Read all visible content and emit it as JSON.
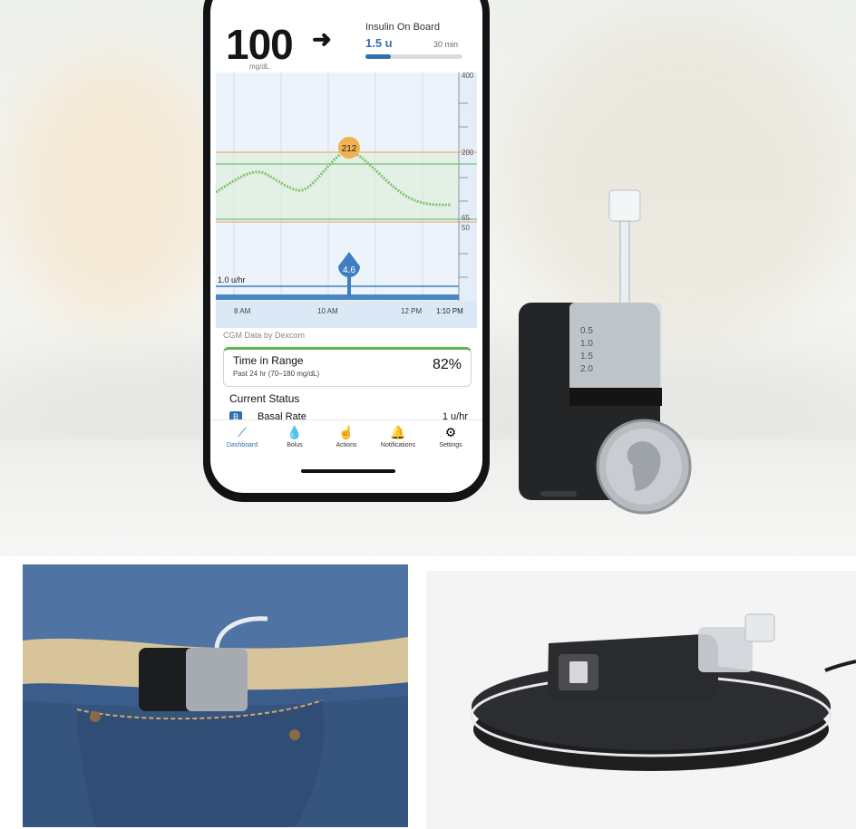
{
  "app": {
    "glucose": {
      "value": "100",
      "unit": "mg/dL",
      "trend_icon": "arrow-right-icon"
    },
    "insulin_on_board": {
      "title": "Insulin On Board",
      "value": "1.5 u",
      "time": "30 min",
      "progress_fraction": 0.26
    },
    "chart": {
      "y_ticks": [
        "400",
        "200",
        "65",
        "50"
      ],
      "x_ticks": [
        "8 AM",
        "10 AM",
        "12 PM",
        "1:10 PM"
      ],
      "peak_label": "212",
      "bolus_marker": "4.6",
      "basal_label": "1.0 u/hr"
    },
    "cgm_source": "CGM Data by Dexcom",
    "time_in_range": {
      "title": "Time in Range",
      "subtitle": "Past 24 hr (70–180 mg/dL)",
      "value": "82%"
    },
    "current_status": {
      "heading": "Current Status",
      "badge": "B",
      "label": "Basal Rate",
      "value": "1 u/hr"
    },
    "nav": [
      {
        "label": "Dashboard",
        "icon": "dashboard-icon"
      },
      {
        "label": "Bolus",
        "icon": "drop-icon"
      },
      {
        "label": "Actions",
        "icon": "hand-icon"
      },
      {
        "label": "Notifications",
        "icon": "bell-icon"
      },
      {
        "label": "Settings",
        "icon": "gear-icon"
      }
    ]
  },
  "pump": {
    "scale_marks": [
      "0.5",
      "1.0",
      "1.5",
      "2.0"
    ]
  },
  "colors": {
    "accent": "#2f6fb0",
    "range_green": "#5ab55a",
    "peak_orange": "#f0b24e",
    "limit_line": "#e8a06a"
  }
}
